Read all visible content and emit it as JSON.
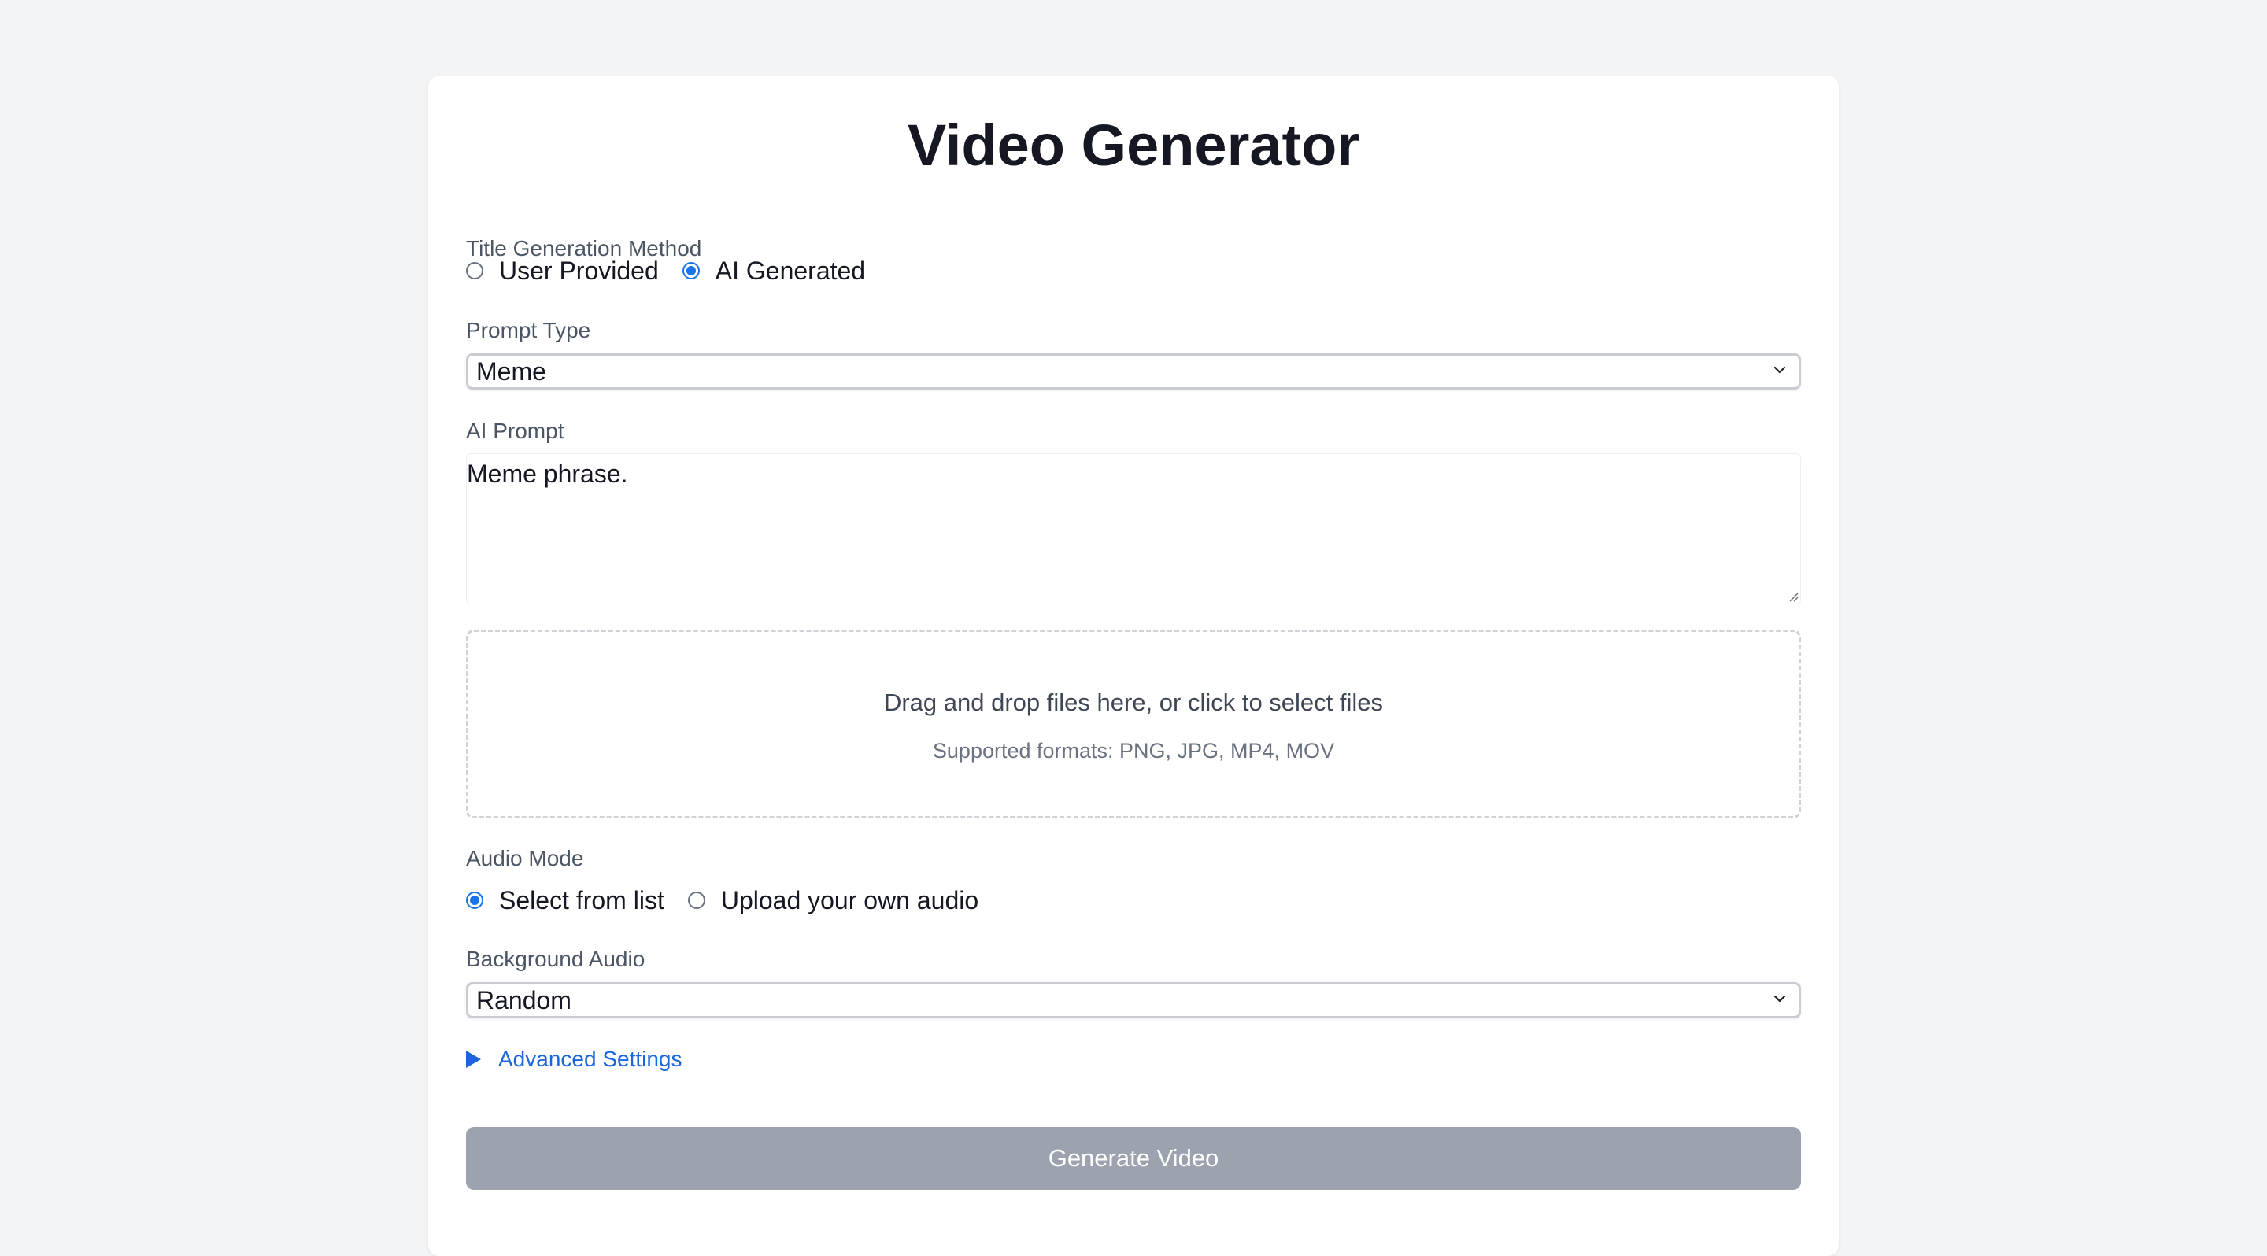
{
  "page": {
    "title": "Video Generator"
  },
  "title_method": {
    "label": "Title Generation Method",
    "options": [
      {
        "label": "User Provided",
        "checked": false
      },
      {
        "label": "AI Generated",
        "checked": true
      }
    ]
  },
  "prompt_type": {
    "label": "Prompt Type",
    "value": "Meme"
  },
  "ai_prompt": {
    "label": "AI Prompt",
    "value": "Meme phrase."
  },
  "dropzone": {
    "text": "Drag and drop files here, or click to select files",
    "formats": "Supported formats: PNG, JPG, MP4, MOV"
  },
  "audio_mode": {
    "label": "Audio Mode",
    "options": [
      {
        "label": "Select from list",
        "checked": true
      },
      {
        "label": "Upload your own audio",
        "checked": false
      }
    ]
  },
  "background_audio": {
    "label": "Background Audio",
    "value": "Random"
  },
  "advanced": {
    "label": "Advanced Settings"
  },
  "generate": {
    "label": "Generate Video"
  },
  "colors": {
    "accent": "#1a73e8",
    "link": "#1a66e0",
    "button_disabled": "#9ca3af",
    "background": "#f3f4f6"
  },
  "icons": {
    "select_chevron": "chevron-down-icon",
    "advanced_toggle": "triangle-right-icon"
  }
}
